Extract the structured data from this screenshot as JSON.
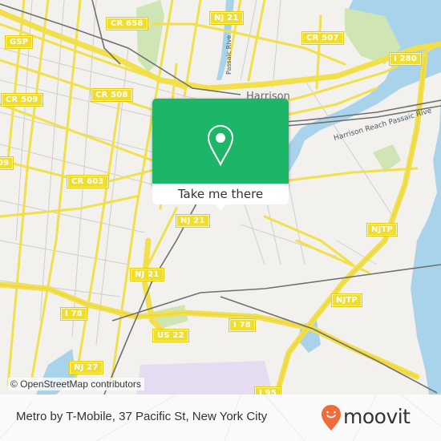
{
  "map": {
    "colors": {
      "land": "#f2f1ed",
      "water": "#a9d3ea",
      "park": "#cfe6b4",
      "road": "#f2df4c",
      "minor_road": "#c9c9c9",
      "rail": "#707070",
      "airport": "#e6dcf2"
    },
    "road_shields": [
      {
        "id": "cr658",
        "label": "CR 658"
      },
      {
        "id": "nj21-top",
        "label": "NJ 21"
      },
      {
        "id": "cr507",
        "label": "CR 507"
      },
      {
        "id": "gsp",
        "label": "GSP"
      },
      {
        "id": "i280",
        "label": "I 280"
      },
      {
        "id": "cr509",
        "label": "CR 509"
      },
      {
        "id": "cr508",
        "label": "CR 508"
      },
      {
        "id": "cr603",
        "label": "CR 603"
      },
      {
        "id": "nj21-mid",
        "label": "NJ 21"
      },
      {
        "id": "nj21-low",
        "label": "NJ 21"
      },
      {
        "id": "njtp-top",
        "label": "NJTP"
      },
      {
        "id": "njtp-low",
        "label": "NJTP"
      },
      {
        "id": "i78-left",
        "label": "I 78"
      },
      {
        "id": "i78-right",
        "label": "I 78"
      },
      {
        "id": "us22",
        "label": "US 22"
      },
      {
        "id": "nj27",
        "label": "NJ 27"
      },
      {
        "id": "i95",
        "label": "I 95"
      },
      {
        "id": "edge-09",
        "label": "09"
      }
    ],
    "place_labels": {
      "harrison": "Harrison"
    },
    "water_labels": {
      "passaic_vertical": "Passaic Rive",
      "harrison_reach": "Harrison Reach Passaic Rive"
    },
    "attribution": "© OpenStreetMap contributors"
  },
  "popup": {
    "icon": "location-pin-icon",
    "button_label": "Take me there",
    "color": "#1db567"
  },
  "footer": {
    "title": "Metro by T-Mobile, 37 Pacific St, New York City",
    "brand": "moovit",
    "brand_color": "#f26b3a"
  }
}
